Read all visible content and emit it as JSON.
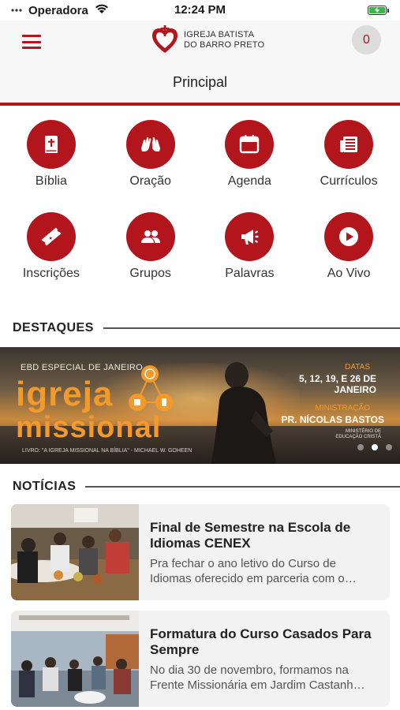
{
  "status_bar": {
    "carrier": "Operadora",
    "time": "12:24 PM",
    "battery_charging": true
  },
  "header": {
    "logo_line1": "IGREJA BATISTA",
    "logo_line2": "DO BARRO PRETO",
    "cart_count": "0",
    "page_title": "Principal"
  },
  "menu": {
    "items": [
      {
        "label": "Bíblia",
        "icon": "bible-icon"
      },
      {
        "label": "Oração",
        "icon": "praying-hands-icon"
      },
      {
        "label": "Agenda",
        "icon": "calendar-icon"
      },
      {
        "label": "Currículos",
        "icon": "newspaper-icon"
      },
      {
        "label": "Inscrições",
        "icon": "ticket-icon"
      },
      {
        "label": "Grupos",
        "icon": "group-icon"
      },
      {
        "label": "Palavras",
        "icon": "megaphone-icon"
      },
      {
        "label": "Ao Vivo",
        "icon": "play-icon"
      }
    ]
  },
  "highlights": {
    "heading": "DESTAQUES",
    "banner": {
      "kicker": "EBD ESPECIAL DE JANEIRO",
      "title_line1": "igreja",
      "title_line2": "missional",
      "book": "LIVRO: \"A IGREJA MISSIONAL NA BÍBLIA\" - MICHAEL W. GOHEEN",
      "dates_label": "DATAS",
      "dates": "5, 12, 19, E 26 DE JANEIRO",
      "ministry_label": "MINISTRAÇÃO",
      "pastor": "PR. NÍCOLAS BASTOS",
      "department": "MINISTÉRIO DE EDUCAÇÃO CRISTÃ"
    },
    "pager": {
      "count": 3,
      "active": 1
    }
  },
  "news": {
    "heading": "NOTÍCIAS",
    "items": [
      {
        "title": "Final de Semestre na Escola de Idiomas CENEX",
        "excerpt": "Pra fechar o ano letivo do Curso de Idiomas oferecido em parceria com o…"
      },
      {
        "title": "Formatura do Curso Casados Para Sempre",
        "excerpt": "No dia 30 de novembro, formamos na Frente Missionária em Jardim Castanh…"
      }
    ]
  },
  "colors": {
    "brand_red": "#b3151c",
    "banner_orange": "#f39a2b"
  }
}
